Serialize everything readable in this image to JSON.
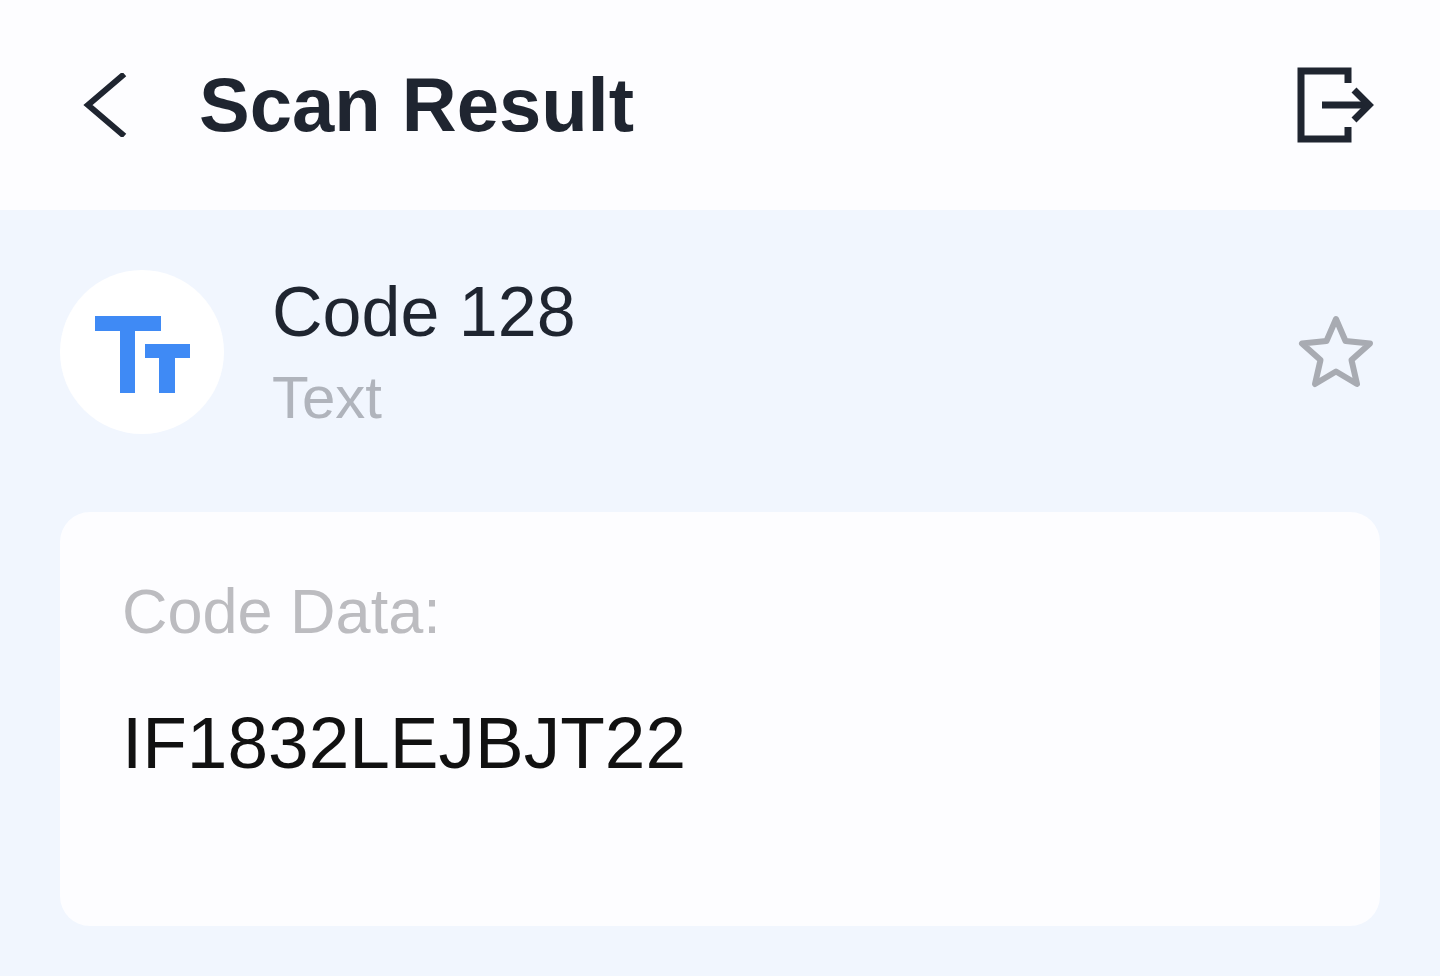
{
  "header": {
    "title": "Scan Result"
  },
  "result": {
    "format": "Code 128",
    "type": "Text",
    "starred": false
  },
  "code_data": {
    "label": "Code Data:",
    "value": "IF1832LEJBJT22"
  }
}
